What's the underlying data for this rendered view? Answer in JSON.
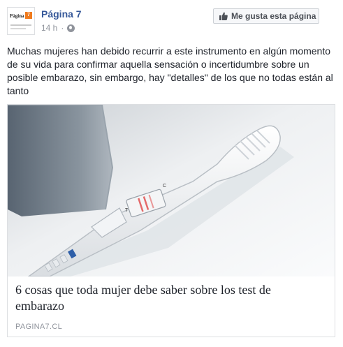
{
  "page": {
    "name": "Página 7",
    "avatar_brand": "Página",
    "avatar_badge": "7",
    "time": "14 h",
    "separator": "·"
  },
  "header": {
    "like_button_label": "Me gusta esta página"
  },
  "post": {
    "caption": "Muchas mujeres han debido recurrir a este instrumento en algún momento de su vida para confirmar aquella sensación o incertidumbre sobre un posible embarazo, sin embargo, hay \"detalles\" de los que no todas están al tanto"
  },
  "link": {
    "title": "6 cosas que toda mujer debe saber sobre los test de embarazo",
    "domain": "PAGINA7.CL",
    "image_description_icon": "pregnancy-test-photo",
    "test_window_label_t": "T",
    "test_window_label_c": "C"
  },
  "colors": {
    "link_blue": "#365899",
    "meta_gray": "#90949c",
    "text": "#1d2129",
    "border": "#dddfe2"
  }
}
